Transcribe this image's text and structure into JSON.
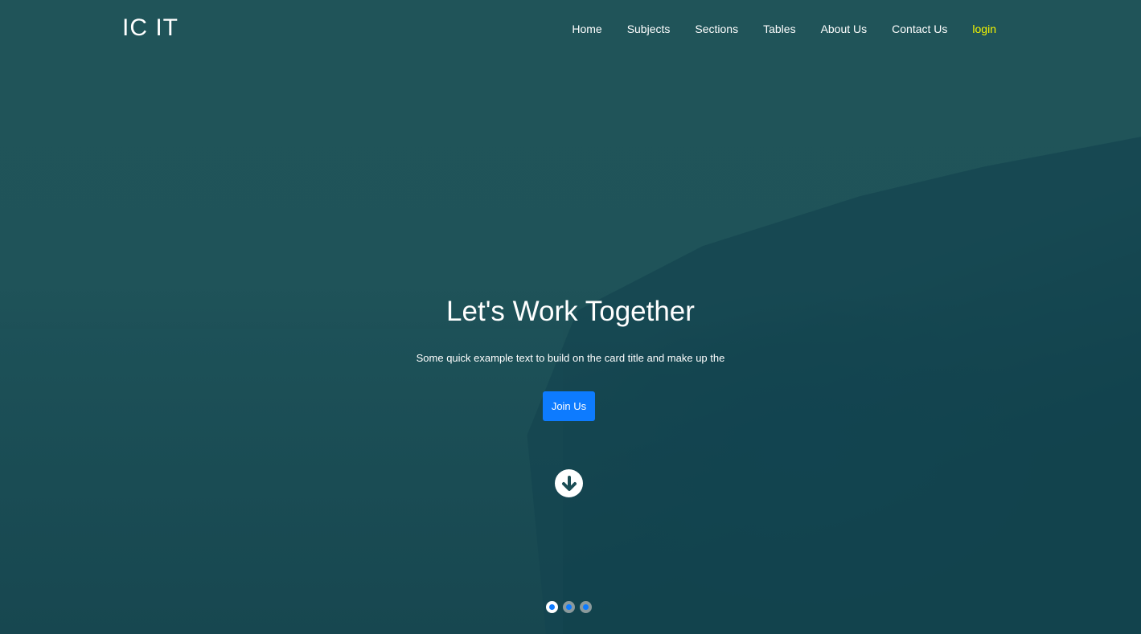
{
  "nav": {
    "brand": "IC IT",
    "links": [
      "Home",
      "Subjects",
      "Sections",
      "Tables",
      "About Us",
      "Contact Us"
    ],
    "login": "login"
  },
  "hero": {
    "title": "Let's Work Together",
    "subtitle": "Some quick example text to build on the card title and make up the",
    "button": "Join Us",
    "scroll_icon": "arrow-down-circle-icon"
  },
  "carousel": {
    "slides": 3,
    "active": 1
  },
  "colors": {
    "accent": "#0d7bff",
    "login": "#f5f500",
    "overlay": "#1f5359"
  }
}
